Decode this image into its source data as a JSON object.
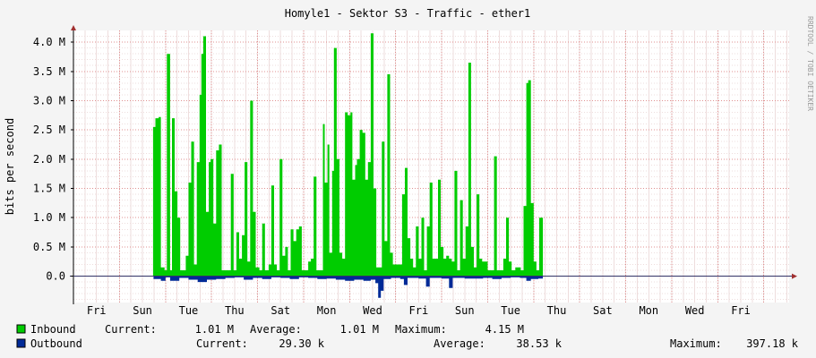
{
  "chart_data": {
    "type": "area",
    "title": "Homyle1 - Sektor S3 - Traffic - ether1",
    "ylabel": "bits per second",
    "watermark": "RRDTOOL / TOBI OETIKER",
    "ylim": [
      -0.45,
      4.2
    ],
    "y_ticks": [
      {
        "value": 0.0,
        "label": "0.0"
      },
      {
        "value": 0.5,
        "label": "0.5 M"
      },
      {
        "value": 1.0,
        "label": "1.0 M"
      },
      {
        "value": 1.5,
        "label": "1.5 M"
      },
      {
        "value": 2.0,
        "label": "2.0 M"
      },
      {
        "value": 2.5,
        "label": "2.5 M"
      },
      {
        "value": 3.0,
        "label": "3.0 M"
      },
      {
        "value": 3.5,
        "label": "3.5 M"
      },
      {
        "value": 4.0,
        "label": "4.0 M"
      }
    ],
    "x_ticks": [
      "Fri",
      "Sun",
      "Tue",
      "Thu",
      "Sat",
      "Mon",
      "Wed",
      "Fri",
      "Sun",
      "Tue",
      "Thu",
      "Sat",
      "Mon",
      "Wed",
      "Fri"
    ],
    "x_days_total": 15.55,
    "series": [
      {
        "name": "Inbound",
        "color": "#00cc00",
        "points": [
          [
            0,
            0
          ],
          [
            1.7,
            0
          ],
          [
            1.73,
            2.55
          ],
          [
            1.78,
            2.7
          ],
          [
            1.85,
            2.72
          ],
          [
            1.9,
            0.15
          ],
          [
            1.98,
            0.1
          ],
          [
            2.03,
            3.8
          ],
          [
            2.1,
            0.1
          ],
          [
            2.14,
            2.7
          ],
          [
            2.2,
            1.45
          ],
          [
            2.26,
            1.0
          ],
          [
            2.32,
            0.1
          ],
          [
            2.38,
            0.1
          ],
          [
            2.44,
            0.35
          ],
          [
            2.5,
            1.6
          ],
          [
            2.56,
            2.3
          ],
          [
            2.62,
            0.2
          ],
          [
            2.68,
            1.95
          ],
          [
            2.74,
            3.1
          ],
          [
            2.78,
            3.8
          ],
          [
            2.82,
            4.1
          ],
          [
            2.88,
            1.1
          ],
          [
            2.94,
            1.95
          ],
          [
            2.98,
            2.0
          ],
          [
            3.04,
            0.9
          ],
          [
            3.1,
            2.15
          ],
          [
            3.16,
            2.25
          ],
          [
            3.22,
            0.1
          ],
          [
            3.38,
            0.1
          ],
          [
            3.42,
            1.75
          ],
          [
            3.48,
            0.1
          ],
          [
            3.54,
            0.75
          ],
          [
            3.6,
            0.3
          ],
          [
            3.66,
            0.7
          ],
          [
            3.72,
            1.95
          ],
          [
            3.78,
            0.25
          ],
          [
            3.84,
            3.0
          ],
          [
            3.9,
            1.1
          ],
          [
            3.96,
            0.15
          ],
          [
            4.04,
            0.1
          ],
          [
            4.1,
            0.9
          ],
          [
            4.16,
            0.1
          ],
          [
            4.24,
            0.2
          ],
          [
            4.3,
            1.55
          ],
          [
            4.36,
            0.2
          ],
          [
            4.42,
            0.1
          ],
          [
            4.48,
            2.0
          ],
          [
            4.54,
            0.35
          ],
          [
            4.6,
            0.5
          ],
          [
            4.66,
            0.1
          ],
          [
            4.72,
            0.8
          ],
          [
            4.78,
            0.6
          ],
          [
            4.84,
            0.8
          ],
          [
            4.9,
            0.85
          ],
          [
            4.96,
            0.1
          ],
          [
            5.04,
            0.1
          ],
          [
            5.1,
            0.25
          ],
          [
            5.16,
            0.3
          ],
          [
            5.22,
            1.7
          ],
          [
            5.28,
            0.1
          ],
          [
            5.36,
            0.1
          ],
          [
            5.42,
            2.6
          ],
          [
            5.46,
            1.6
          ],
          [
            5.52,
            2.25
          ],
          [
            5.56,
            0.4
          ],
          [
            5.62,
            1.8
          ],
          [
            5.66,
            3.9
          ],
          [
            5.72,
            2.0
          ],
          [
            5.78,
            0.4
          ],
          [
            5.84,
            0.3
          ],
          [
            5.9,
            2.8
          ],
          [
            5.96,
            2.75
          ],
          [
            6.02,
            2.8
          ],
          [
            6.06,
            1.65
          ],
          [
            6.12,
            1.9
          ],
          [
            6.16,
            2.0
          ],
          [
            6.22,
            2.5
          ],
          [
            6.28,
            2.45
          ],
          [
            6.34,
            1.65
          ],
          [
            6.4,
            1.95
          ],
          [
            6.46,
            4.15
          ],
          [
            6.52,
            1.5
          ],
          [
            6.58,
            0.15
          ],
          [
            6.64,
            0.15
          ],
          [
            6.7,
            2.3
          ],
          [
            6.76,
            0.6
          ],
          [
            6.82,
            3.45
          ],
          [
            6.88,
            0.4
          ],
          [
            6.94,
            0.2
          ],
          [
            7.04,
            0.2
          ],
          [
            7.14,
            1.4
          ],
          [
            7.2,
            1.85
          ],
          [
            7.26,
            0.65
          ],
          [
            7.32,
            0.3
          ],
          [
            7.38,
            0.15
          ],
          [
            7.44,
            0.85
          ],
          [
            7.5,
            0.3
          ],
          [
            7.56,
            1.0
          ],
          [
            7.62,
            0.1
          ],
          [
            7.68,
            0.85
          ],
          [
            7.74,
            1.6
          ],
          [
            7.8,
            0.3
          ],
          [
            7.86,
            0.3
          ],
          [
            7.92,
            1.65
          ],
          [
            7.98,
            0.5
          ],
          [
            8.04,
            0.3
          ],
          [
            8.1,
            0.35
          ],
          [
            8.16,
            0.3
          ],
          [
            8.22,
            0.25
          ],
          [
            8.28,
            1.8
          ],
          [
            8.34,
            0.1
          ],
          [
            8.4,
            1.3
          ],
          [
            8.46,
            0.3
          ],
          [
            8.52,
            0.85
          ],
          [
            8.58,
            3.65
          ],
          [
            8.64,
            0.5
          ],
          [
            8.7,
            0.15
          ],
          [
            8.76,
            1.4
          ],
          [
            8.82,
            0.3
          ],
          [
            8.88,
            0.25
          ],
          [
            8.94,
            0.25
          ],
          [
            9.0,
            0.1
          ],
          [
            9.08,
            0.1
          ],
          [
            9.14,
            2.05
          ],
          [
            9.2,
            0.1
          ],
          [
            9.28,
            0.1
          ],
          [
            9.34,
            0.3
          ],
          [
            9.4,
            1.0
          ],
          [
            9.46,
            0.25
          ],
          [
            9.52,
            0.1
          ],
          [
            9.6,
            0.15
          ],
          [
            9.66,
            0.15
          ],
          [
            9.72,
            0.1
          ],
          [
            9.78,
            1.2
          ],
          [
            9.84,
            3.3
          ],
          [
            9.88,
            3.35
          ],
          [
            9.94,
            1.25
          ],
          [
            10.0,
            0.25
          ],
          [
            10.06,
            0.1
          ],
          [
            10.12,
            1.0
          ],
          [
            10.2,
            0
          ]
        ]
      },
      {
        "name": "Outbound",
        "color": "#002a97",
        "points": [
          [
            0,
            0
          ],
          [
            1.7,
            0
          ],
          [
            1.74,
            -0.05
          ],
          [
            1.9,
            -0.08
          ],
          [
            2.0,
            -0.02
          ],
          [
            2.1,
            -0.08
          ],
          [
            2.3,
            -0.03
          ],
          [
            2.5,
            -0.06
          ],
          [
            2.7,
            -0.1
          ],
          [
            2.9,
            -0.06
          ],
          [
            3.1,
            -0.05
          ],
          [
            3.3,
            -0.03
          ],
          [
            3.5,
            -0.02
          ],
          [
            3.7,
            -0.06
          ],
          [
            3.9,
            -0.03
          ],
          [
            4.1,
            -0.05
          ],
          [
            4.3,
            -0.02
          ],
          [
            4.5,
            -0.03
          ],
          [
            4.7,
            -0.05
          ],
          [
            4.9,
            -0.02
          ],
          [
            5.1,
            -0.03
          ],
          [
            5.3,
            -0.05
          ],
          [
            5.5,
            -0.04
          ],
          [
            5.7,
            -0.06
          ],
          [
            5.9,
            -0.08
          ],
          [
            6.1,
            -0.06
          ],
          [
            6.3,
            -0.08
          ],
          [
            6.46,
            -0.06
          ],
          [
            6.56,
            -0.12
          ],
          [
            6.62,
            -0.37
          ],
          [
            6.68,
            -0.25
          ],
          [
            6.74,
            -0.05
          ],
          [
            6.9,
            -0.03
          ],
          [
            7.1,
            -0.05
          ],
          [
            7.18,
            -0.15
          ],
          [
            7.26,
            -0.03
          ],
          [
            7.5,
            -0.04
          ],
          [
            7.66,
            -0.18
          ],
          [
            7.74,
            -0.03
          ],
          [
            8.0,
            -0.04
          ],
          [
            8.16,
            -0.2
          ],
          [
            8.24,
            -0.03
          ],
          [
            8.5,
            -0.04
          ],
          [
            8.7,
            -0.04
          ],
          [
            8.9,
            -0.03
          ],
          [
            9.1,
            -0.05
          ],
          [
            9.3,
            -0.03
          ],
          [
            9.5,
            -0.02
          ],
          [
            9.7,
            -0.03
          ],
          [
            9.84,
            -0.08
          ],
          [
            9.94,
            -0.05
          ],
          [
            10.1,
            -0.04
          ],
          [
            10.2,
            0
          ]
        ]
      }
    ]
  },
  "legend": {
    "inbound": {
      "name": "Inbound",
      "color": "#00cc00",
      "current_label": "Current:",
      "current": "1.01 M",
      "average_label": "Average:",
      "average": "1.01 M",
      "maximum_label": "Maximum:",
      "maximum": "4.15 M"
    },
    "outbound": {
      "name": "Outbound",
      "color": "#002a97",
      "current_label": "Current:",
      "current": "29.30 k",
      "average_label": "Average:",
      "average": "38.53 k",
      "maximum_label": "Maximum:",
      "maximum": "397.18 k"
    }
  }
}
